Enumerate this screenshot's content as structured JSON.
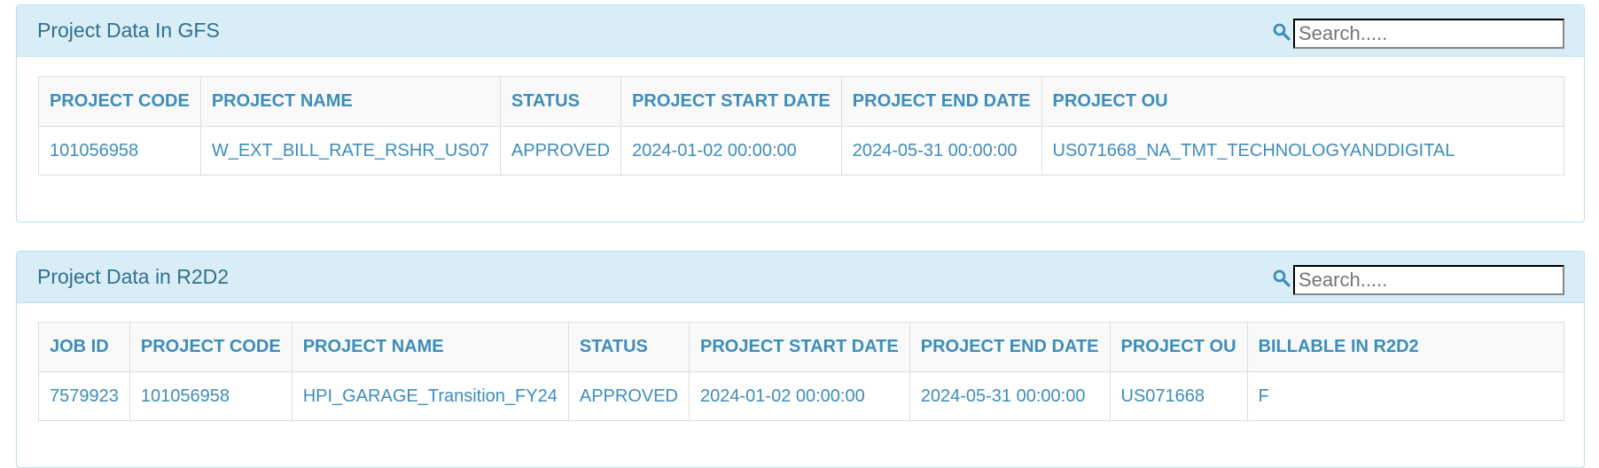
{
  "panels": {
    "gfs": {
      "title": "Project Data In GFS",
      "search_placeholder": "Search.....",
      "columns": [
        "PROJECT CODE",
        "PROJECT NAME",
        "STATUS",
        "PROJECT START DATE",
        "PROJECT END DATE",
        "PROJECT OU"
      ],
      "rows": [
        [
          "101056958",
          "W_EXT_BILL_RATE_RSHR_US07",
          "APPROVED",
          "2024-01-02 00:00:00",
          "2024-05-31 00:00:00",
          "US071668_NA_TMT_TECHNOLOGYANDDIGITAL"
        ]
      ]
    },
    "r2d2": {
      "title": "Project Data in R2D2",
      "search_placeholder": "Search.....",
      "columns": [
        "JOB ID",
        "PROJECT CODE",
        "PROJECT NAME",
        "STATUS",
        "PROJECT START DATE",
        "PROJECT END DATE",
        "PROJECT OU",
        "BILLABLE IN R2D2"
      ],
      "rows": [
        [
          "7579923",
          "101056958",
          "HPI_GARAGE_Transition_FY24",
          "APPROVED",
          "2024-01-02 00:00:00",
          "2024-05-31 00:00:00",
          "US071668",
          "F"
        ]
      ]
    }
  },
  "icons": {
    "search": "search-icon"
  },
  "colors": {
    "heading_bg": "#d9edf7",
    "title": "#31708f",
    "link": "#3c8dbc",
    "border": "#bcdfe9"
  }
}
